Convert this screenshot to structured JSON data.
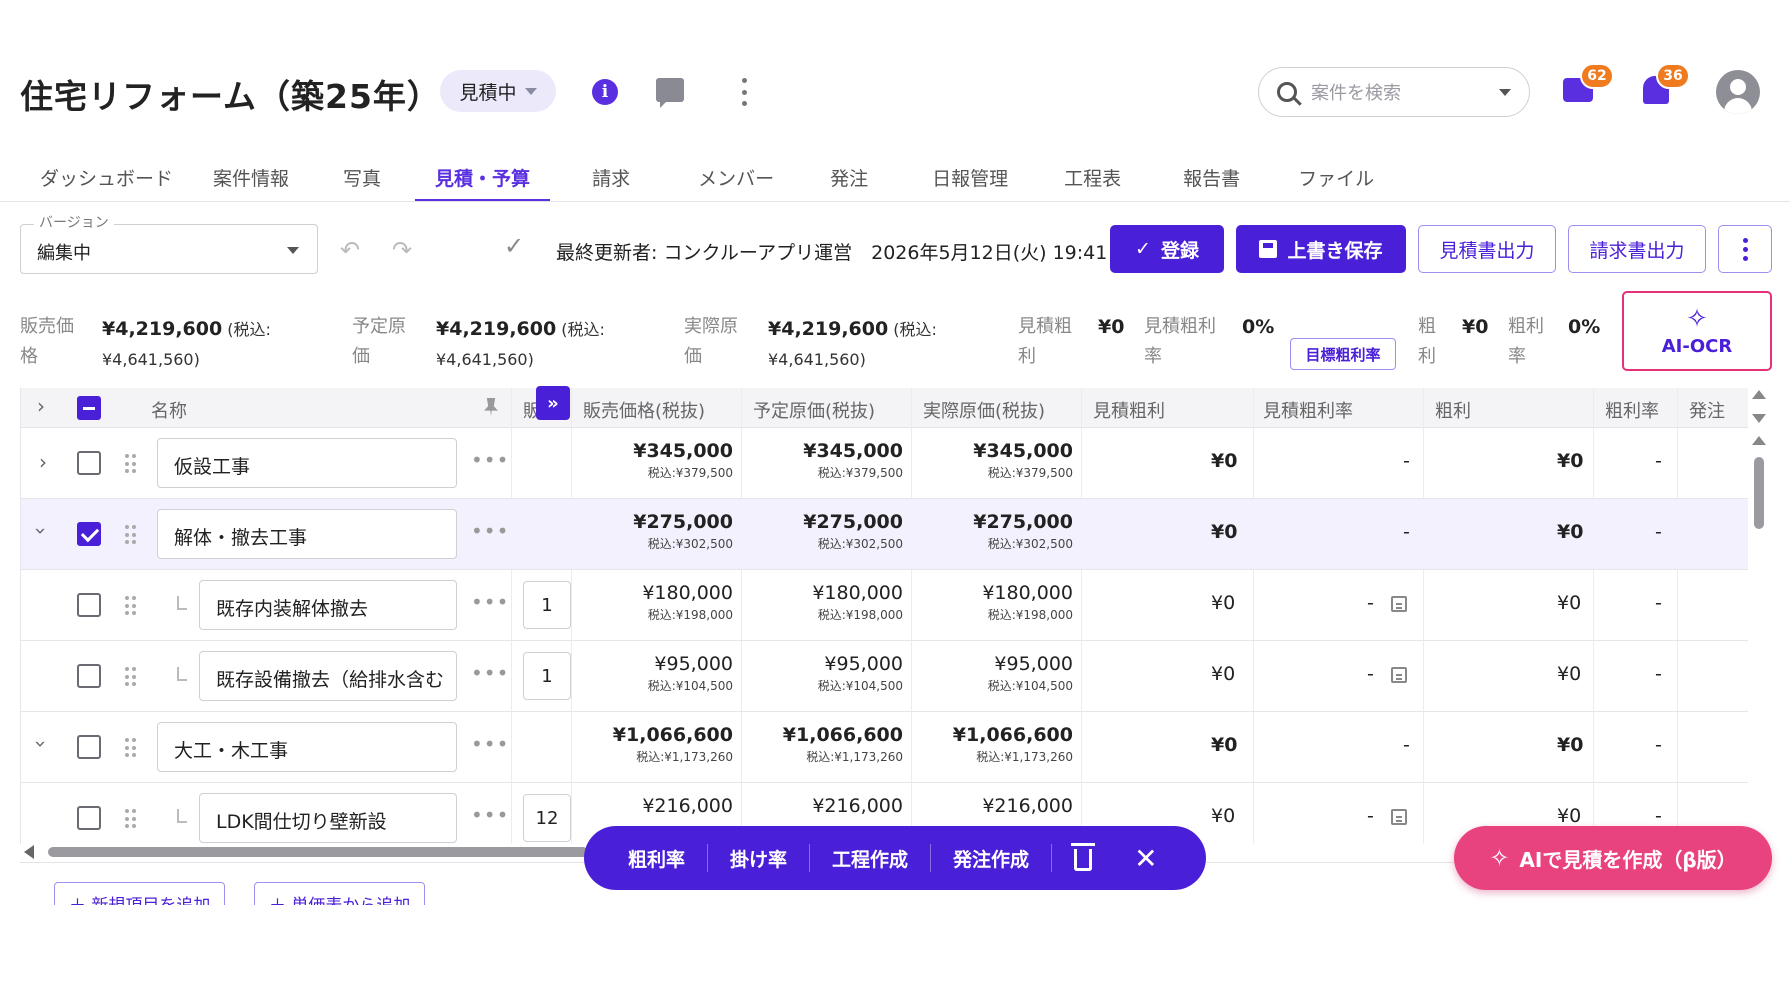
{
  "header": {
    "title": "住宅リフォーム（築25年）",
    "status": "見積中",
    "search_placeholder": "案件を検索",
    "messages_count": "62",
    "notifications_count": "36"
  },
  "tabs": [
    {
      "label": "ダッシュボード"
    },
    {
      "label": "案件情報"
    },
    {
      "label": "写真"
    },
    {
      "label": "見積・予算"
    },
    {
      "label": "請求"
    },
    {
      "label": "メンバー"
    },
    {
      "label": "発注"
    },
    {
      "label": "日報管理"
    },
    {
      "label": "工程表"
    },
    {
      "label": "報告書"
    },
    {
      "label": "ファイル"
    }
  ],
  "toolbar": {
    "version_label": "バージョン",
    "version_value": "編集中",
    "last_updated": "最終更新者: コンクルーアプリ運営　2026年5月12日(火) 19:41",
    "register_label": "登録",
    "save_label": "上書き保存",
    "estimate_output_label": "見積書出力",
    "invoice_output_label": "請求書出力"
  },
  "summary": {
    "sales_label_1": "販売価",
    "sales_label_2": "格",
    "sales_value": "¥4,219,600",
    "sales_tax_1": "(税込:",
    "sales_tax_2": "¥4,641,560)",
    "planned_label_1": "予定原",
    "planned_label_2": "価",
    "planned_value": "¥4,219,600",
    "planned_tax_1": "(税込:",
    "planned_tax_2": "¥4,641,560)",
    "actual_label_1": "実際原",
    "actual_label_2": "価",
    "actual_value": "¥4,219,600",
    "actual_tax_1": "(税込:",
    "actual_tax_2": "¥4,641,560)",
    "est_margin_label_1": "見積粗",
    "est_margin_label_2": "利",
    "est_margin_value": "¥0",
    "est_margin_rate_label_1": "見積粗利",
    "est_margin_rate_label_2": "率",
    "est_margin_rate_value": "0%",
    "target_margin_button": "目標粗利率",
    "margin_label_1": "粗",
    "margin_label_2": "利",
    "margin_value": "¥0",
    "margin_rate_label_1": "粗利",
    "margin_rate_label_2": "率",
    "margin_rate_value": "0%",
    "ai_ocr_label": "AI-OCR"
  },
  "table": {
    "columns": {
      "name": "名称",
      "sales_short": "販",
      "sales": "販売価格(税抜)",
      "planned": "予定原価(税抜)",
      "actual": "実際原価(税抜)",
      "est_margin": "見積粗利",
      "est_margin_rate": "見積粗利率",
      "margin": "粗利",
      "margin_rate": "粗利率",
      "order": "発注"
    },
    "rows": [
      {
        "name": "仮設工事",
        "qty": "",
        "sales": "¥345,000",
        "sales_tax": "税込:¥379,500",
        "planned": "¥345,000",
        "planned_tax": "税込:¥379,500",
        "actual": "¥345,000",
        "actual_tax": "税込:¥379,500",
        "est_margin": "¥0",
        "est_margin_rate": "-",
        "margin": "¥0",
        "margin_rate": "-"
      },
      {
        "name": "解体・撤去工事",
        "qty": "",
        "sales": "¥275,000",
        "sales_tax": "税込:¥302,500",
        "planned": "¥275,000",
        "planned_tax": "税込:¥302,500",
        "actual": "¥275,000",
        "actual_tax": "税込:¥302,500",
        "est_margin": "¥0",
        "est_margin_rate": "-",
        "margin": "¥0",
        "margin_rate": "-"
      },
      {
        "name": "既存内装解体撤去",
        "qty": "1",
        "sales": "¥180,000",
        "sales_tax": "税込:¥198,000",
        "planned": "¥180,000",
        "planned_tax": "税込:¥198,000",
        "actual": "¥180,000",
        "actual_tax": "税込:¥198,000",
        "est_margin": "¥0",
        "est_margin_rate": "-",
        "margin": "¥0",
        "margin_rate": "-"
      },
      {
        "name": "既存設備撤去（給排水含む",
        "qty": "1",
        "sales": "¥95,000",
        "sales_tax": "税込:¥104,500",
        "planned": "¥95,000",
        "planned_tax": "税込:¥104,500",
        "actual": "¥95,000",
        "actual_tax": "税込:¥104,500",
        "est_margin": "¥0",
        "est_margin_rate": "-",
        "margin": "¥0",
        "margin_rate": "-"
      },
      {
        "name": "大工・木工事",
        "qty": "",
        "sales": "¥1,066,600",
        "sales_tax": "税込:¥1,173,260",
        "planned": "¥1,066,600",
        "planned_tax": "税込:¥1,173,260",
        "actual": "¥1,066,600",
        "actual_tax": "税込:¥1,173,260",
        "est_margin": "¥0",
        "est_margin_rate": "-",
        "margin": "¥0",
        "margin_rate": "-"
      },
      {
        "name": "LDK間仕切り壁新設",
        "qty": "12",
        "sales": "¥216,000",
        "sales_tax": "",
        "planned": "¥216,000",
        "planned_tax": "",
        "actual": "¥216,000",
        "actual_tax": "",
        "est_margin": "¥0",
        "est_margin_rate": "-",
        "margin": "¥0",
        "margin_rate": "-"
      }
    ]
  },
  "action_bar": {
    "margin_rate": "粗利率",
    "multiplier": "掛け率",
    "create_schedule": "工程作成",
    "create_order": "発注作成"
  },
  "ai_estimate_label": "AIで見積を作成（β版）",
  "add_buttons": {
    "new_item": "＋ 新規項目を追加",
    "from_master": "＋ 単価表から追加"
  },
  "colors": {
    "primary": "#4a1fd8",
    "accent_pink": "#e8437f",
    "badge_orange": "#f07a1e"
  }
}
